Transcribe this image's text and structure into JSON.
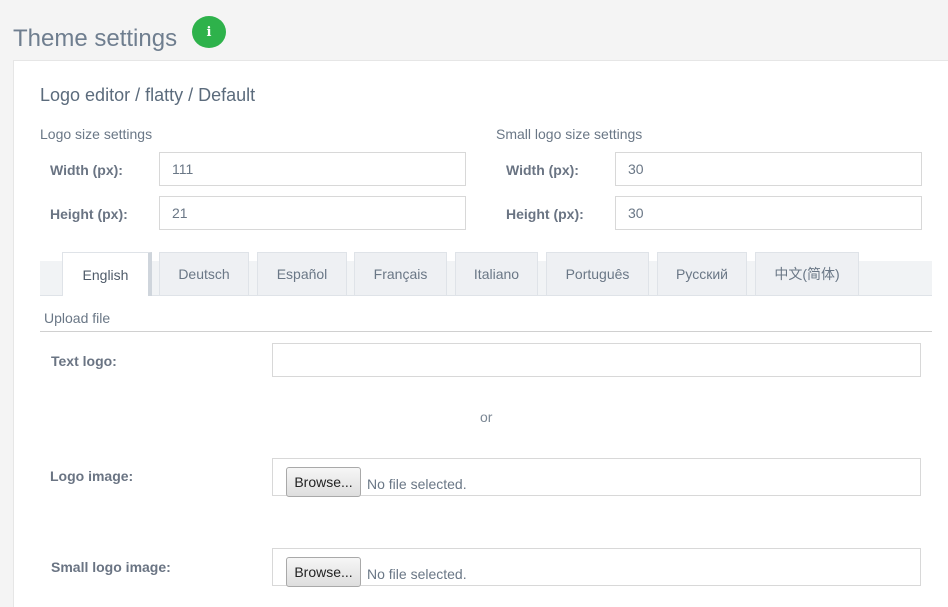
{
  "header": {
    "title": "Theme settings",
    "info_glyph": "i",
    "info_icon": "info-icon",
    "info_color": "#2eb24b"
  },
  "editor": {
    "breadcrumb": "Logo editor / flatty / Default",
    "logo_size": {
      "section_label": "Logo size settings",
      "width_label": "Width (px):",
      "width_value": "111",
      "height_label": "Height (px):",
      "height_value": "21"
    },
    "small_logo_size": {
      "section_label": "Small logo size settings",
      "width_label": "Width (px):",
      "width_value": "30",
      "height_label": "Height (px):",
      "height_value": "30"
    }
  },
  "tabs": [
    {
      "label": "English",
      "active": true
    },
    {
      "label": "Deutsch",
      "active": false
    },
    {
      "label": "Español",
      "active": false
    },
    {
      "label": "Français",
      "active": false
    },
    {
      "label": "Italiano",
      "active": false
    },
    {
      "label": "Português",
      "active": false
    },
    {
      "label": "Русский",
      "active": false
    },
    {
      "label": "中文(简体)",
      "active": false
    }
  ],
  "upload": {
    "subtab_label": "Upload file",
    "text_logo_label": "Text logo:",
    "text_logo_value": "",
    "or_text": "or",
    "logo_image_label": "Logo image:",
    "small_logo_image_label": "Small logo image:",
    "browse_label": "Browse...",
    "no_file_text": "No file selected."
  }
}
